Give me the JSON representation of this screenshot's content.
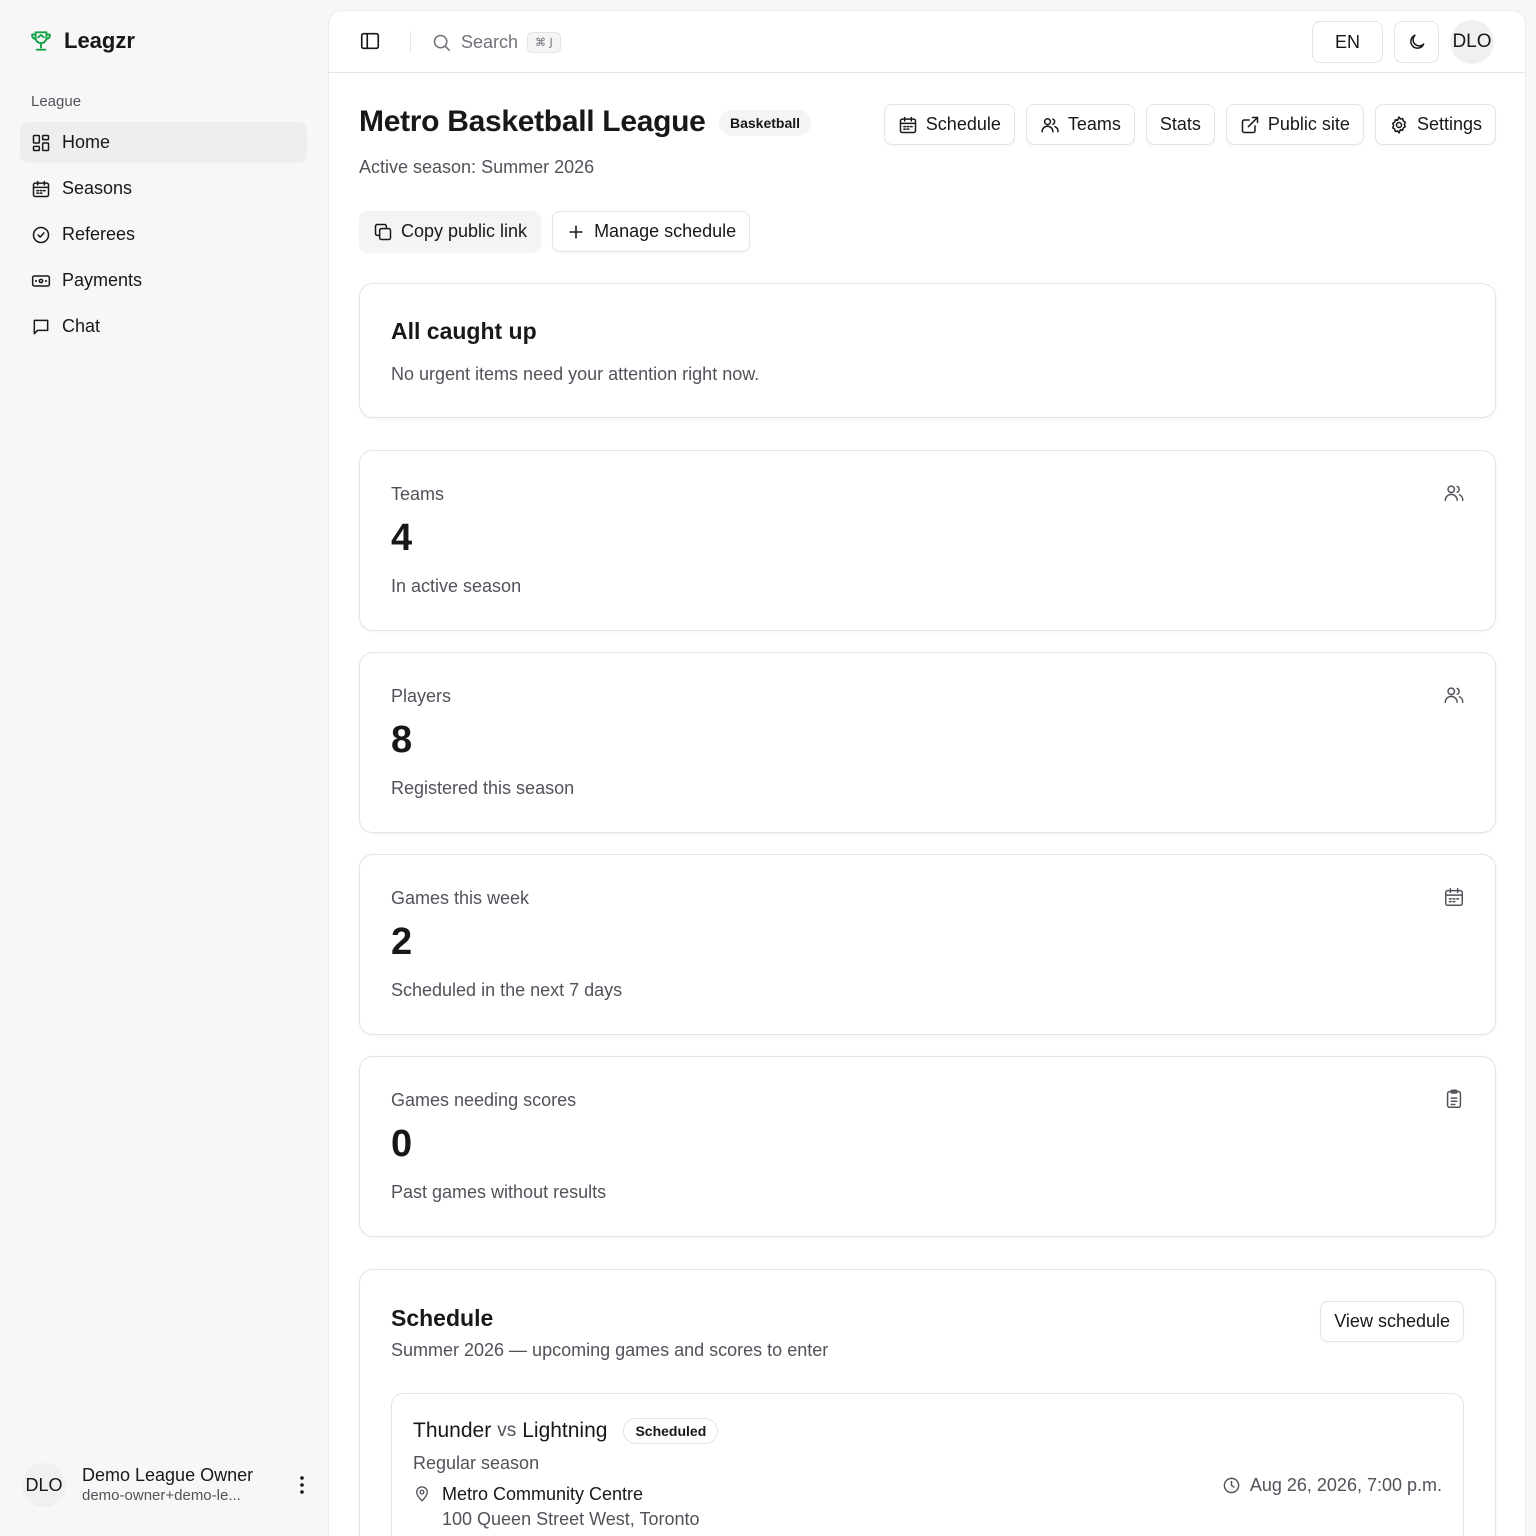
{
  "app": {
    "name": "Leagzr",
    "accent": "#16a34a"
  },
  "sidebar": {
    "section_label": "League",
    "items": [
      {
        "label": "Home",
        "icon": "dashboard-icon",
        "active": true
      },
      {
        "label": "Seasons",
        "icon": "calendar-icon"
      },
      {
        "label": "Referees",
        "icon": "badge-check-icon"
      },
      {
        "label": "Payments",
        "icon": "banknote-icon"
      },
      {
        "label": "Chat",
        "icon": "message-icon"
      }
    ],
    "user": {
      "initials": "DLO",
      "name": "Demo League Owner",
      "email": "demo-owner+demo-le..."
    }
  },
  "topbar": {
    "search_label": "Search",
    "search_shortcut": "⌘ J",
    "language": "EN",
    "avatar_initials": "DLO"
  },
  "league": {
    "title": "Metro Basketball League",
    "sport": "Basketball",
    "season_line": "Active season: Summer 2026"
  },
  "header_actions": {
    "schedule": "Schedule",
    "teams": "Teams",
    "stats": "Stats",
    "public_site": "Public site",
    "settings": "Settings"
  },
  "quick_actions": {
    "copy_link": "Copy public link",
    "manage_schedule": "Manage schedule"
  },
  "alert": {
    "title": "All caught up",
    "text": "No urgent items need your attention right now."
  },
  "stats": [
    {
      "label": "Teams",
      "value": "4",
      "sub": "In active season",
      "icon": "users-icon"
    },
    {
      "label": "Players",
      "value": "8",
      "sub": "Registered this season",
      "icon": "users-icon"
    },
    {
      "label": "Games this week",
      "value": "2",
      "sub": "Scheduled in the next 7 days",
      "icon": "calendar-icon"
    },
    {
      "label": "Games needing scores",
      "value": "0",
      "sub": "Past games without results",
      "icon": "clipboard-icon"
    }
  ],
  "schedule": {
    "title": "Schedule",
    "subtitle": "Summer 2026 — upcoming games and scores to enter",
    "view_button": "View schedule",
    "games": [
      {
        "home": "Thunder",
        "vs": "vs",
        "away": "Lightning",
        "status": "Scheduled",
        "type": "Regular season",
        "venue": "Metro Community Centre",
        "address": "100 Queen Street West, Toronto",
        "datetime": "Aug 26, 2026, 7:00 p.m."
      }
    ]
  }
}
